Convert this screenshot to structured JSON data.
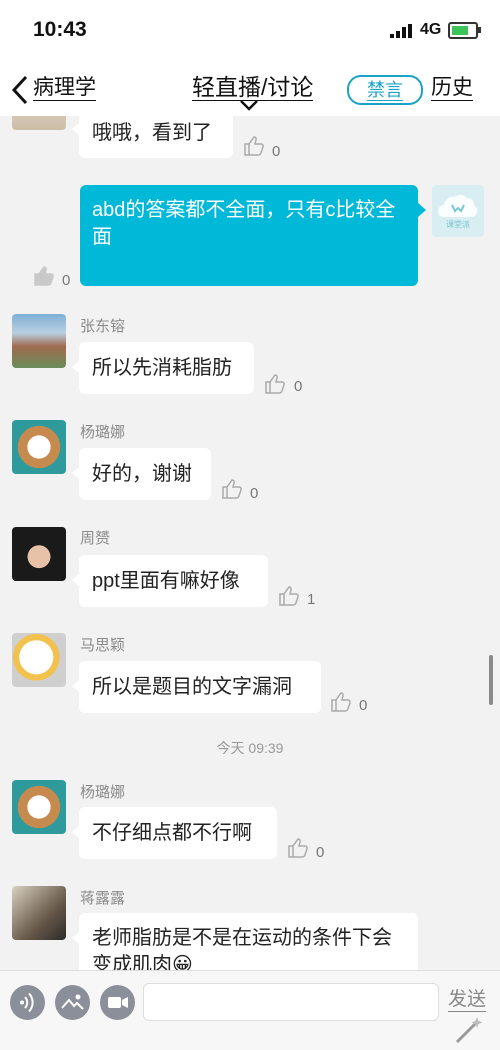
{
  "status_bar": {
    "time": "10:43",
    "network": "4G"
  },
  "nav": {
    "back_label": "病理学",
    "title": "轻直播/讨论",
    "mute_label": "禁言",
    "history_label": "历史"
  },
  "messages": [
    {
      "sender": "",
      "text": "哦哦，看到了",
      "likes": "0"
    },
    {
      "sender": "",
      "text": "abd的答案都不全面，只有c比较全面",
      "likes": "0",
      "self": true
    },
    {
      "sender": "张东镕",
      "text": "所以先消耗脂肪",
      "likes": "0"
    },
    {
      "sender": "杨璐娜",
      "text": "好的，谢谢",
      "likes": "0"
    },
    {
      "sender": "周赟",
      "text": "ppt里面有嘛好像",
      "likes": "1"
    },
    {
      "sender": "马思颖",
      "text": "所以是题目的文字漏洞",
      "likes": "0"
    },
    {
      "sender": "杨璐娜",
      "text": "不仔细点都不行啊",
      "likes": "0"
    },
    {
      "sender": "蒋露露",
      "text": "老师脂肪是不是在运动的条件下会变成肌肉😀",
      "likes": ""
    }
  ],
  "timestamp": "今天 09:39",
  "self_avatar_text": "课堂派",
  "input_bar": {
    "send_label": "发送",
    "input_value": "",
    "icons": [
      "voice-icon",
      "image-icon",
      "video-icon"
    ]
  },
  "colors": {
    "accent": "#1aa3c8",
    "self_bubble": "#00b8d8",
    "background": "#f2f2f2"
  }
}
